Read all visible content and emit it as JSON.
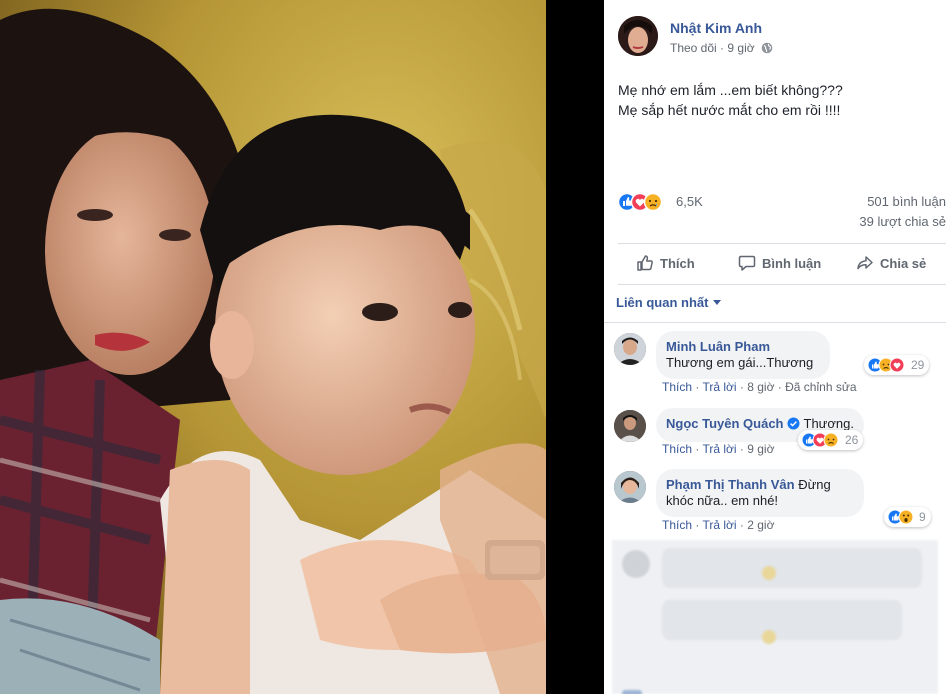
{
  "post": {
    "author": "Nhật Kim Anh",
    "follow": "Theo dõi",
    "separator": "·",
    "time": "9 giờ",
    "privacy_icon": "globe-icon",
    "text_line1": "Mẹ nhớ em lắm ...em biết không???",
    "text_line2": "Mẹ sắp hết nước mắt cho em rồi !!!!",
    "reaction_icons": [
      "like-icon",
      "love-icon",
      "sad-icon"
    ],
    "reaction_count": "6,5K",
    "comments_count": "501 bình luận",
    "shares_count": "39 lượt chia sẻ"
  },
  "actions": {
    "like": "Thích",
    "comment": "Bình luận",
    "share": "Chia sẻ"
  },
  "sort_label": "Liên quan nhất",
  "comments": [
    {
      "name": "Minh Luân Pham",
      "text": "Thương em gái...Thương",
      "like": "Thích",
      "reply": "Trả lời",
      "time": "8 giờ",
      "edited": "Đã chỉnh sửa",
      "reaction_count": "29",
      "verified": false
    },
    {
      "name": "Ngọc Tuyên Quách",
      "text": "Thương.",
      "like": "Thích",
      "reply": "Trả lời",
      "time": "9 giờ",
      "edited": "",
      "reaction_count": "26",
      "verified": true
    },
    {
      "name": "Phạm Thị Thanh Vân",
      "text": "Đừng khóc nữa.. em nhé!",
      "like": "Thích",
      "reply": "Trả lời",
      "time": "2 giờ",
      "edited": "",
      "reaction_count": "9",
      "verified": false
    }
  ],
  "colors": {
    "link": "#385898",
    "like_blue": "#1877f2",
    "love_red": "#f33e58",
    "sad_yellow": "#f7b125"
  }
}
